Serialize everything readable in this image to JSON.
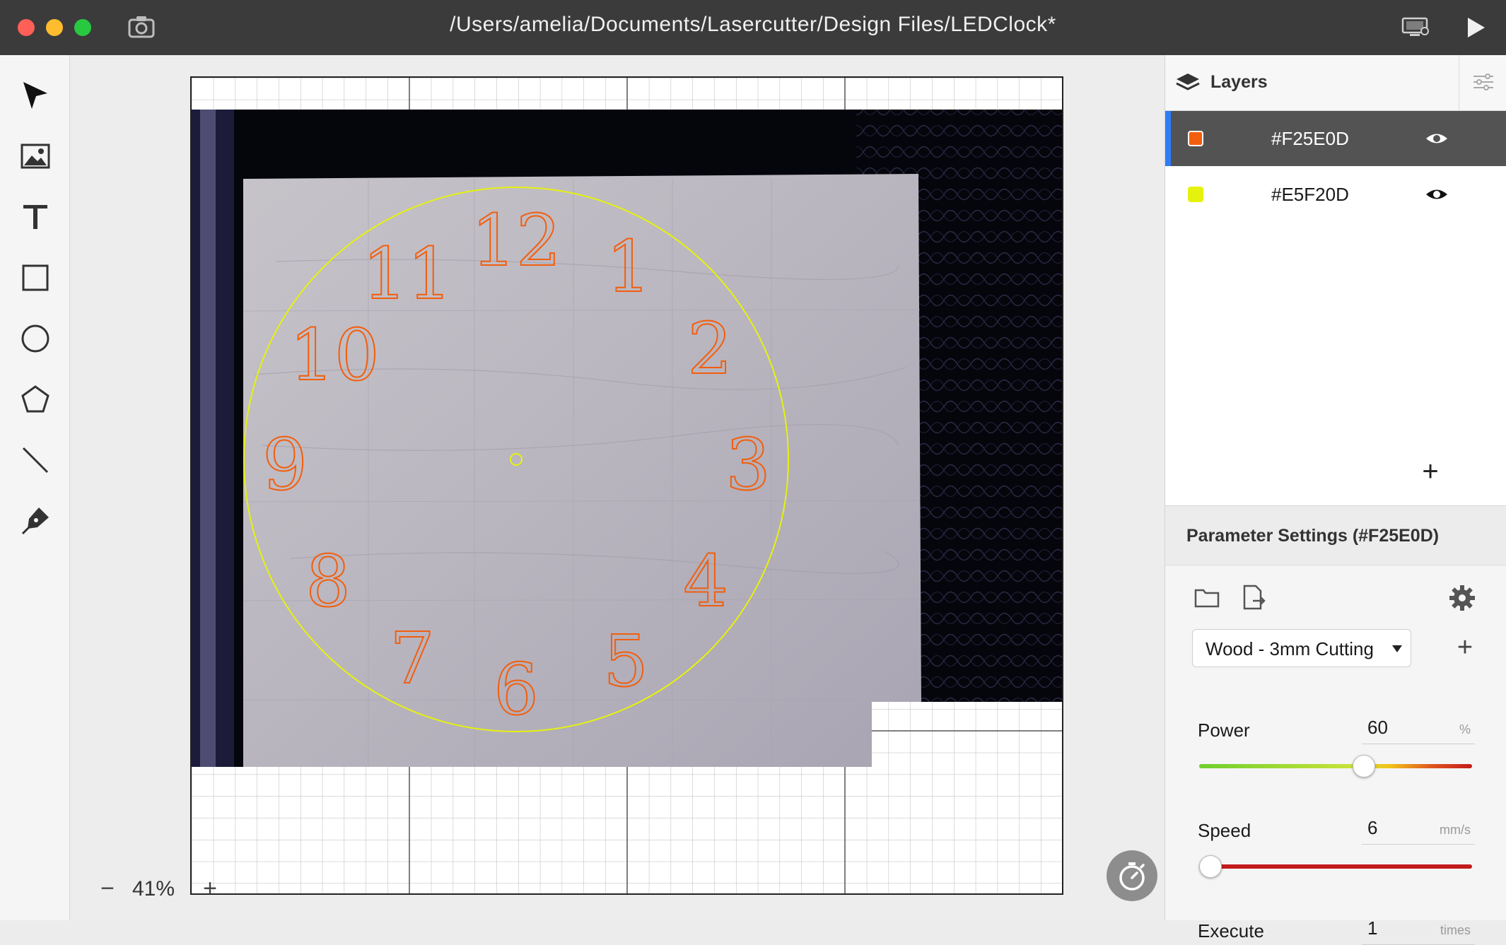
{
  "window": {
    "title": "/Users/amelia/Documents/Lasercutter/Design Files/LEDClock*"
  },
  "colors": {
    "layer1": "#F25E0D",
    "layer2": "#E5F20D",
    "selection_accent": "#2f7cf6"
  },
  "toolbar": {
    "tools": [
      "select-tool",
      "image-tool",
      "text-tool",
      "rectangle-tool",
      "ellipse-tool",
      "polygon-tool",
      "line-tool",
      "pen-tool"
    ]
  },
  "canvas": {
    "zoom_minus": "−",
    "zoom_label": "41%",
    "zoom_plus": "+",
    "clock_numbers": [
      "12",
      "1",
      "2",
      "3",
      "4",
      "5",
      "6",
      "7",
      "8",
      "9",
      "10",
      "11"
    ]
  },
  "layers": {
    "title": "Layers",
    "items": [
      {
        "name": "#F25E0D",
        "color": "#F25E0D",
        "selected": true,
        "visible": true
      },
      {
        "name": "#E5F20D",
        "color": "#E5F20D",
        "selected": false,
        "visible": true
      }
    ],
    "add_label": "+"
  },
  "parameters": {
    "title": "Parameter Settings (#F25E0D)",
    "preset": "Wood - 3mm Cutting",
    "preset_add": "+",
    "power": {
      "label": "Power",
      "value": "60",
      "unit": "%",
      "level": 0.6
    },
    "speed": {
      "label": "Speed",
      "value": "6",
      "unit": "mm/s",
      "level": 0.04
    },
    "execute": {
      "label": "Execute",
      "value": "1",
      "unit": "times"
    }
  }
}
